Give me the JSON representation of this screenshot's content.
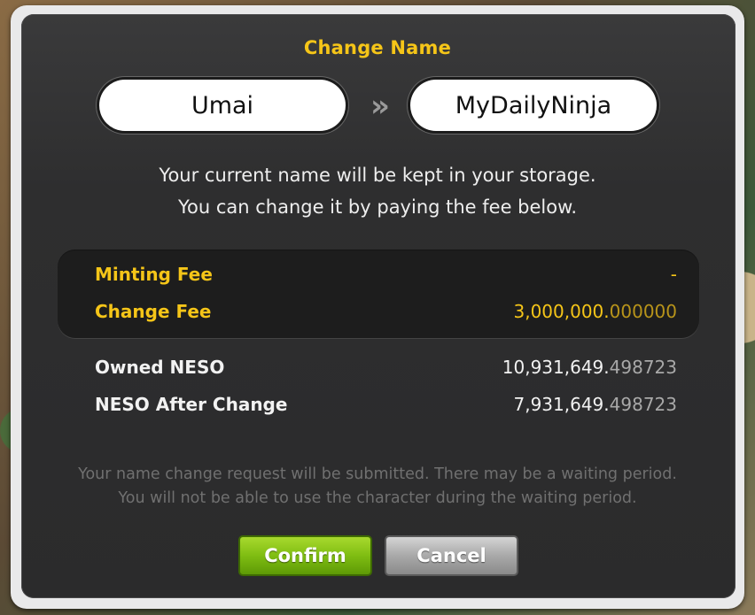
{
  "dialog": {
    "title": "Change Name",
    "current_name": "Umai",
    "new_name": "MyDailyNinja",
    "arrow_icon": "double-chevron-right-icon",
    "info_line1": "Your current name will be kept in your storage.",
    "info_line2": "You can change it by paying the fee below."
  },
  "fees": {
    "minting_label": "Minting Fee",
    "minting_value": "-",
    "change_label": "Change Fee",
    "change_value_int": "3,000,000.",
    "change_value_dec": "000000"
  },
  "balance": {
    "owned_label": "Owned NESO",
    "owned_value_int": "10,931,649.",
    "owned_value_dec": "498723",
    "after_label": "NESO After Change",
    "after_value_int": "7,931,649.",
    "after_value_dec": "498723"
  },
  "notice": {
    "line1": "Your name change request will be submitted. There may be a waiting period.",
    "line2": "You will not be able to use the character during the waiting period."
  },
  "buttons": {
    "confirm": "Confirm",
    "cancel": "Cancel"
  },
  "colors": {
    "accent_gold": "#f5c518",
    "confirm_green": "#7fbd12",
    "panel_dark": "#2b2b2c"
  }
}
